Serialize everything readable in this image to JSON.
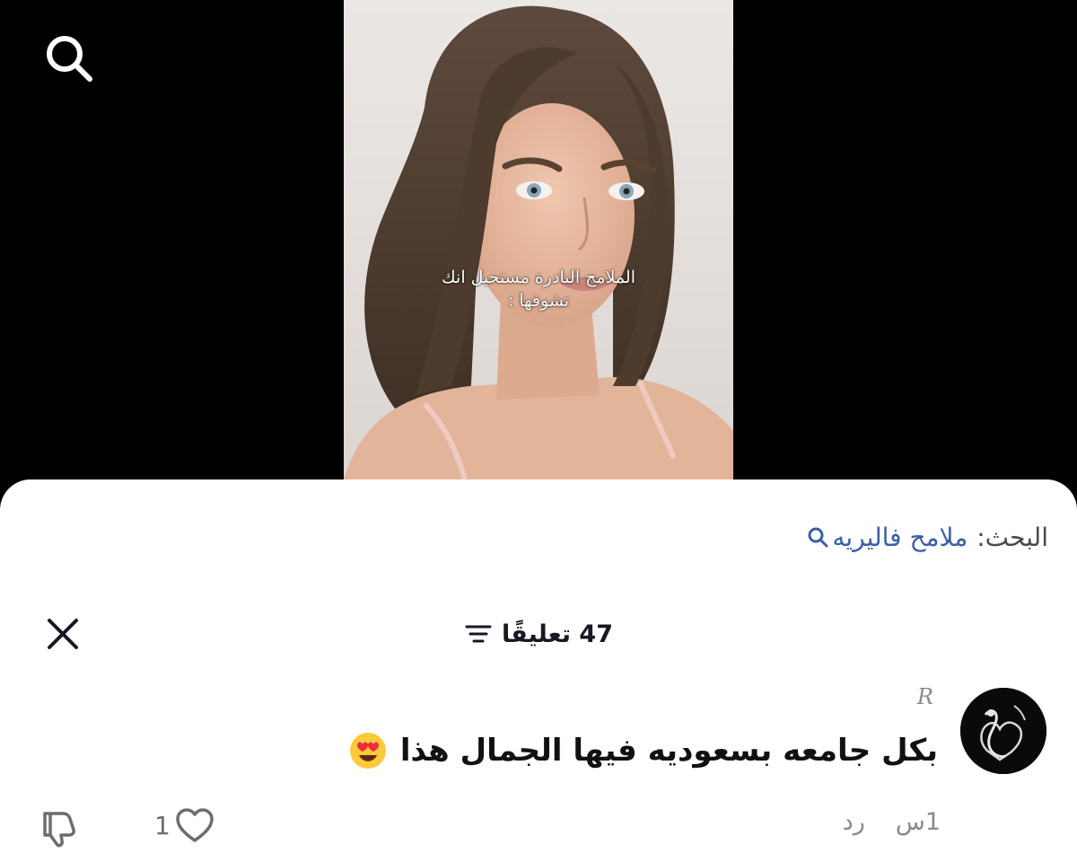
{
  "video": {
    "caption_line1": "الملامح النادرة مستحيل انك",
    "caption_line2": "تشوفها :"
  },
  "search": {
    "label": "البحث:",
    "term": "ملامح فاليريه"
  },
  "comments": {
    "title": "47 تعليقًا"
  },
  "comment": {
    "username": "R",
    "text": "بكل جامعه بسعوديه فيها الجمال هذا",
    "emoji": "heart-eyes-emoji",
    "time": "1س",
    "reply_label": "رد",
    "like_count": "1"
  },
  "icons": {
    "search": "search-icon",
    "close": "close-icon",
    "filter": "filter-icon",
    "like": "heart-icon",
    "dislike": "thumbs-down-icon"
  },
  "colors": {
    "link": "#3a5fa5",
    "meta_text": "#8a8a8a"
  }
}
